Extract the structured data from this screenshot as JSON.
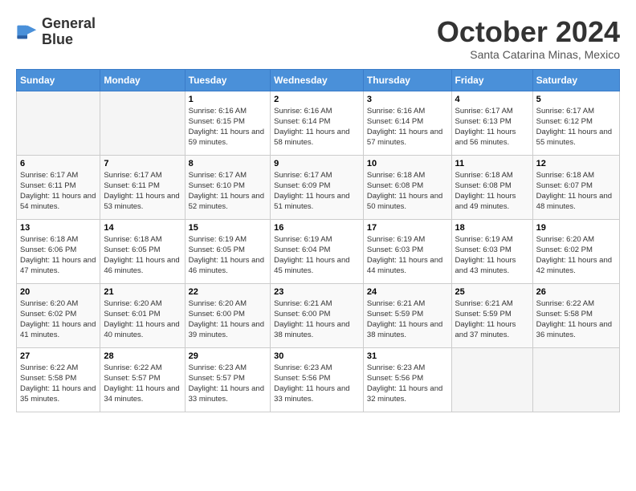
{
  "header": {
    "logo_line1": "General",
    "logo_line2": "Blue",
    "month": "October 2024",
    "location": "Santa Catarina Minas, Mexico"
  },
  "weekdays": [
    "Sunday",
    "Monday",
    "Tuesday",
    "Wednesday",
    "Thursday",
    "Friday",
    "Saturday"
  ],
  "weeks": [
    [
      {
        "num": "",
        "info": ""
      },
      {
        "num": "",
        "info": ""
      },
      {
        "num": "1",
        "info": "Sunrise: 6:16 AM\nSunset: 6:15 PM\nDaylight: 11 hours and 59 minutes."
      },
      {
        "num": "2",
        "info": "Sunrise: 6:16 AM\nSunset: 6:14 PM\nDaylight: 11 hours and 58 minutes."
      },
      {
        "num": "3",
        "info": "Sunrise: 6:16 AM\nSunset: 6:14 PM\nDaylight: 11 hours and 57 minutes."
      },
      {
        "num": "4",
        "info": "Sunrise: 6:17 AM\nSunset: 6:13 PM\nDaylight: 11 hours and 56 minutes."
      },
      {
        "num": "5",
        "info": "Sunrise: 6:17 AM\nSunset: 6:12 PM\nDaylight: 11 hours and 55 minutes."
      }
    ],
    [
      {
        "num": "6",
        "info": "Sunrise: 6:17 AM\nSunset: 6:11 PM\nDaylight: 11 hours and 54 minutes."
      },
      {
        "num": "7",
        "info": "Sunrise: 6:17 AM\nSunset: 6:11 PM\nDaylight: 11 hours and 53 minutes."
      },
      {
        "num": "8",
        "info": "Sunrise: 6:17 AM\nSunset: 6:10 PM\nDaylight: 11 hours and 52 minutes."
      },
      {
        "num": "9",
        "info": "Sunrise: 6:17 AM\nSunset: 6:09 PM\nDaylight: 11 hours and 51 minutes."
      },
      {
        "num": "10",
        "info": "Sunrise: 6:18 AM\nSunset: 6:08 PM\nDaylight: 11 hours and 50 minutes."
      },
      {
        "num": "11",
        "info": "Sunrise: 6:18 AM\nSunset: 6:08 PM\nDaylight: 11 hours and 49 minutes."
      },
      {
        "num": "12",
        "info": "Sunrise: 6:18 AM\nSunset: 6:07 PM\nDaylight: 11 hours and 48 minutes."
      }
    ],
    [
      {
        "num": "13",
        "info": "Sunrise: 6:18 AM\nSunset: 6:06 PM\nDaylight: 11 hours and 47 minutes."
      },
      {
        "num": "14",
        "info": "Sunrise: 6:18 AM\nSunset: 6:05 PM\nDaylight: 11 hours and 46 minutes."
      },
      {
        "num": "15",
        "info": "Sunrise: 6:19 AM\nSunset: 6:05 PM\nDaylight: 11 hours and 46 minutes."
      },
      {
        "num": "16",
        "info": "Sunrise: 6:19 AM\nSunset: 6:04 PM\nDaylight: 11 hours and 45 minutes."
      },
      {
        "num": "17",
        "info": "Sunrise: 6:19 AM\nSunset: 6:03 PM\nDaylight: 11 hours and 44 minutes."
      },
      {
        "num": "18",
        "info": "Sunrise: 6:19 AM\nSunset: 6:03 PM\nDaylight: 11 hours and 43 minutes."
      },
      {
        "num": "19",
        "info": "Sunrise: 6:20 AM\nSunset: 6:02 PM\nDaylight: 11 hours and 42 minutes."
      }
    ],
    [
      {
        "num": "20",
        "info": "Sunrise: 6:20 AM\nSunset: 6:02 PM\nDaylight: 11 hours and 41 minutes."
      },
      {
        "num": "21",
        "info": "Sunrise: 6:20 AM\nSunset: 6:01 PM\nDaylight: 11 hours and 40 minutes."
      },
      {
        "num": "22",
        "info": "Sunrise: 6:20 AM\nSunset: 6:00 PM\nDaylight: 11 hours and 39 minutes."
      },
      {
        "num": "23",
        "info": "Sunrise: 6:21 AM\nSunset: 6:00 PM\nDaylight: 11 hours and 38 minutes."
      },
      {
        "num": "24",
        "info": "Sunrise: 6:21 AM\nSunset: 5:59 PM\nDaylight: 11 hours and 38 minutes."
      },
      {
        "num": "25",
        "info": "Sunrise: 6:21 AM\nSunset: 5:59 PM\nDaylight: 11 hours and 37 minutes."
      },
      {
        "num": "26",
        "info": "Sunrise: 6:22 AM\nSunset: 5:58 PM\nDaylight: 11 hours and 36 minutes."
      }
    ],
    [
      {
        "num": "27",
        "info": "Sunrise: 6:22 AM\nSunset: 5:58 PM\nDaylight: 11 hours and 35 minutes."
      },
      {
        "num": "28",
        "info": "Sunrise: 6:22 AM\nSunset: 5:57 PM\nDaylight: 11 hours and 34 minutes."
      },
      {
        "num": "29",
        "info": "Sunrise: 6:23 AM\nSunset: 5:57 PM\nDaylight: 11 hours and 33 minutes."
      },
      {
        "num": "30",
        "info": "Sunrise: 6:23 AM\nSunset: 5:56 PM\nDaylight: 11 hours and 33 minutes."
      },
      {
        "num": "31",
        "info": "Sunrise: 6:23 AM\nSunset: 5:56 PM\nDaylight: 11 hours and 32 minutes."
      },
      {
        "num": "",
        "info": ""
      },
      {
        "num": "",
        "info": ""
      }
    ]
  ]
}
